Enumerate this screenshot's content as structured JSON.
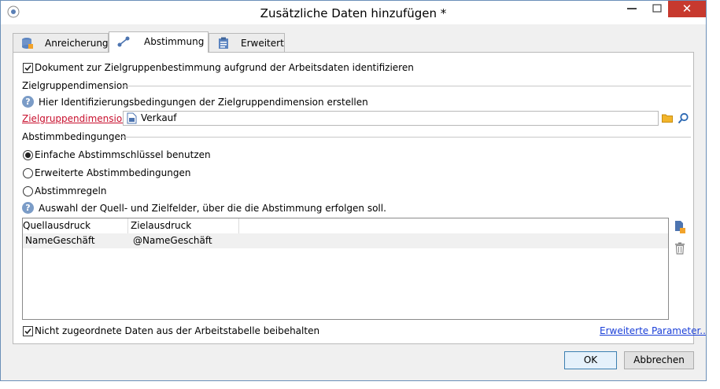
{
  "window": {
    "title": "Zusätzliche Daten hinzufügen *",
    "close_glyph": "✕"
  },
  "tabs": [
    {
      "label": "Anreicherung",
      "icon": "database-icon"
    },
    {
      "label": "Abstimmung",
      "icon": "link-icon"
    },
    {
      "label": "Erweitert",
      "icon": "clipboard-icon"
    }
  ],
  "main": {
    "identify_checkbox_label": "Dokument zur Zielgruppenbestimmung aufgrund der Arbeitsdaten identifizieren",
    "identify_checked": true,
    "section_target": "Zielgruppendimension",
    "help_target": "Hier Identifizierungsbedingungen der Zielgruppendimension erstellen",
    "target_label": "Zielgruppendimension:",
    "target_value": "Verkauf",
    "section_conditions": "Abstimmbedingungen",
    "radios": [
      {
        "label": "Einfache Abstimmschlüssel benutzen",
        "selected": true
      },
      {
        "label": "Erweiterte Abstimmbedingungen",
        "selected": false
      },
      {
        "label": "Abstimmregeln",
        "selected": false
      }
    ],
    "help_fields": "Auswahl der Quell- und Zielfelder, über die die Abstimmung erfolgen soll.",
    "table": {
      "columns": [
        "Quellausdruck",
        "Zielausdruck"
      ],
      "rows": [
        [
          "NameGeschäft",
          "@NameGeschäft"
        ]
      ]
    },
    "keep_checkbox_label": "Nicht zugeordnete Daten aus der Arbeitstabelle beibehalten",
    "keep_checked": true,
    "advanced_link": "Erweiterte Parameter.."
  },
  "footer": {
    "ok_label": "OK",
    "cancel_label": "Abbrechen"
  },
  "colors": {
    "accent": "#3c7fb1",
    "required_label": "#c8102e",
    "close_button": "#c7392e",
    "link": "#1a3fd8"
  }
}
